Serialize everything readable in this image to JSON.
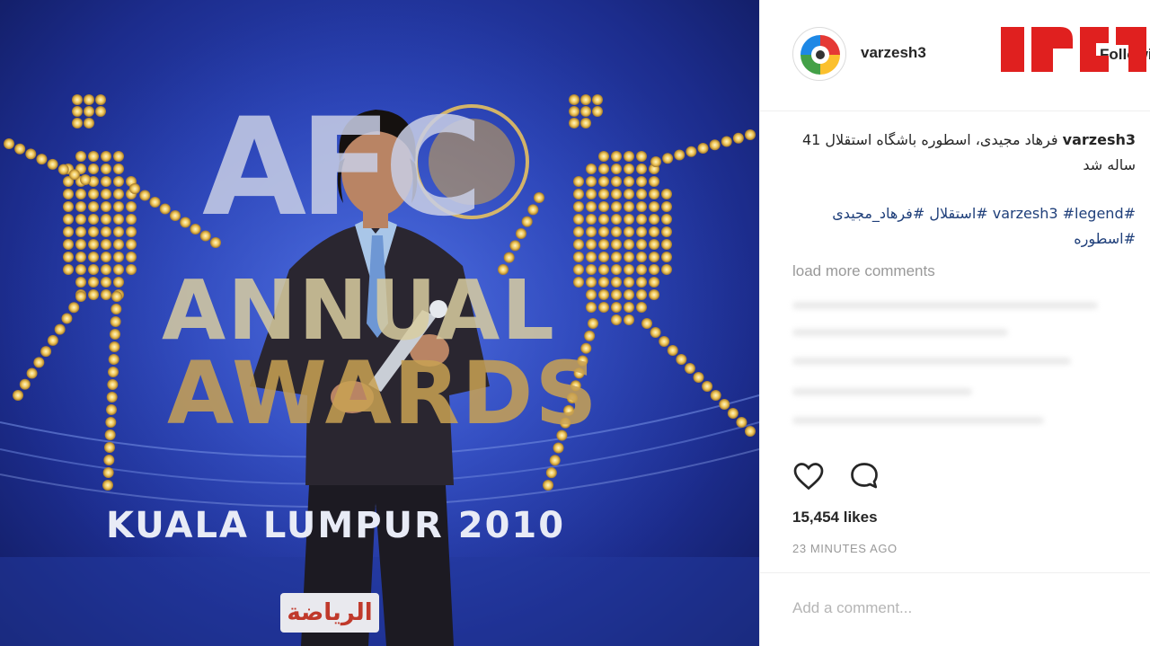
{
  "photo": {
    "backdrop": {
      "afc": "AFC",
      "annual": "ANNUAL",
      "awards": "AWARDS",
      "location": "KUALA LUMPUR 2010",
      "sponsor": "الرياضة"
    }
  },
  "post": {
    "username": "varzesh3",
    "follow_label": "Following",
    "caption_user": "varzesh3",
    "caption_text": "فرهاد مجیدی، اسطوره باشگاه استقلال 41 ساله شد",
    "hashtags": "#varzesh3 #legend #استقلال #فرهاد_مجیدی #اسطوره",
    "load_more": "load more comments",
    "likes": "15,454 likes",
    "timestamp": "23 MINUTES AGO",
    "comment_placeholder": "Add a comment..."
  },
  "icons": {
    "like": "heart-icon",
    "comment": "speech-bubble-icon",
    "avatar": "varzesh3-logo",
    "watermark": "brand-logo"
  },
  "colors": {
    "backdrop_blue": "#2a43b6",
    "light_gold": "#f0c75a",
    "hashtag": "#1f3f7a",
    "muted": "#999999",
    "watermark_red": "#e0201f"
  }
}
